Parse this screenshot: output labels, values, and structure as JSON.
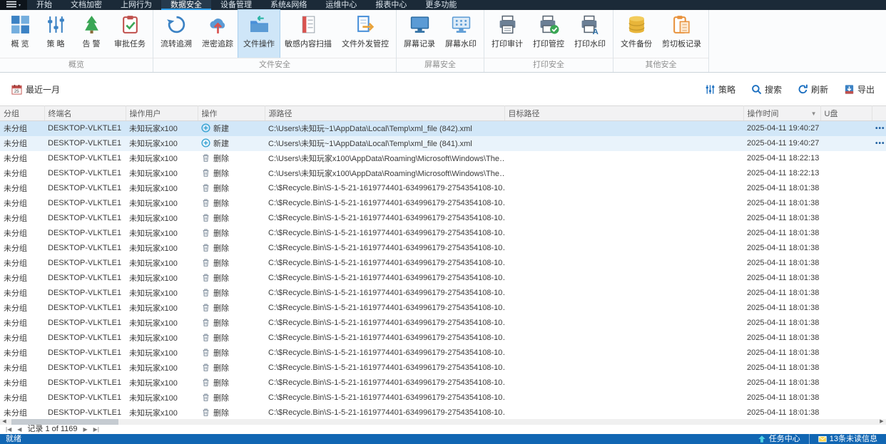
{
  "menubar": {
    "tabs": [
      {
        "label": "开始"
      },
      {
        "label": "文档加密"
      },
      {
        "label": "上网行为"
      },
      {
        "label": "数据安全",
        "active": true
      },
      {
        "label": "设备管理"
      },
      {
        "label": "系统&网络"
      },
      {
        "label": "运维中心"
      },
      {
        "label": "报表中心"
      },
      {
        "label": "更多功能"
      }
    ]
  },
  "ribbon": {
    "groups": [
      {
        "label": "概览",
        "items": [
          {
            "label": "概 览",
            "icon": "grid-icon"
          },
          {
            "label": "策 略",
            "icon": "sliders-icon"
          },
          {
            "label": "告 警",
            "icon": "alert-tree-icon"
          },
          {
            "label": "审批任务",
            "icon": "approval-clipboard-icon"
          }
        ]
      },
      {
        "label": "文件安全",
        "items": [
          {
            "label": "流转追溯",
            "icon": "flow-trace-icon"
          },
          {
            "label": "泄密追踪",
            "icon": "leak-track-icon"
          },
          {
            "label": "文件操作",
            "icon": "file-operations-icon",
            "active": true
          },
          {
            "label": "敏感内容扫描",
            "icon": "content-scan-icon"
          },
          {
            "label": "文件外发管控",
            "icon": "file-outgoing-icon"
          }
        ]
      },
      {
        "label": "屏幕安全",
        "items": [
          {
            "label": "屏幕记录",
            "icon": "screen-record-icon"
          },
          {
            "label": "屏幕水印",
            "icon": "screen-watermark-icon"
          }
        ]
      },
      {
        "label": "打印安全",
        "items": [
          {
            "label": "打印审计",
            "icon": "print-audit-icon"
          },
          {
            "label": "打印管控",
            "icon": "print-control-icon"
          },
          {
            "label": "打印水印",
            "icon": "print-watermark-icon"
          }
        ]
      },
      {
        "label": "其他安全",
        "items": [
          {
            "label": "文件备份",
            "icon": "file-backup-icon"
          },
          {
            "label": "剪切板记录",
            "icon": "clipboard-record-icon"
          }
        ]
      }
    ]
  },
  "filterbar": {
    "date_filter": {
      "label": "最近一月",
      "icon": "calendar-icon"
    },
    "actions": [
      {
        "label": "策略",
        "name": "policy-button",
        "icon": "sliders-small-icon"
      },
      {
        "label": "搜索",
        "name": "search-button",
        "icon": "search-icon"
      },
      {
        "label": "刷新",
        "name": "refresh-button",
        "icon": "refresh-icon"
      },
      {
        "label": "导出",
        "name": "export-button",
        "icon": "export-icon"
      }
    ]
  },
  "table": {
    "columns": [
      {
        "label": "分组"
      },
      {
        "label": "终端名"
      },
      {
        "label": "操作用户"
      },
      {
        "label": "操作"
      },
      {
        "label": "源路径"
      },
      {
        "label": "目标路径"
      },
      {
        "label": "操作时间",
        "dropdown": true
      },
      {
        "label": "U盘"
      }
    ],
    "chevron": "▼",
    "row_menu_glyph": "•••",
    "rows": [
      {
        "group": "未分组",
        "terminal": "DESKTOP-VLKTLE1",
        "user": "未知玩家x100",
        "op": "新建",
        "op_type": "create",
        "source": "C:\\Users\\未知玩~1\\AppData\\Local\\Temp\\xml_file (842).xml",
        "target": "",
        "time": "2025-04-11 19:40:27",
        "usb": "",
        "state": "sel1",
        "menu": true
      },
      {
        "group": "未分组",
        "terminal": "DESKTOP-VLKTLE1",
        "user": "未知玩家x100",
        "op": "新建",
        "op_type": "create",
        "source": "C:\\Users\\未知玩~1\\AppData\\Local\\Temp\\xml_file (841).xml",
        "target": "",
        "time": "2025-04-11 19:40:27",
        "usb": "",
        "state": "sel2",
        "menu": true
      },
      {
        "group": "未分组",
        "terminal": "DESKTOP-VLKTLE1",
        "user": "未知玩家x100",
        "op": "删除",
        "op_type": "delete",
        "source": "C:\\Users\\未知玩家x100\\AppData\\Roaming\\Microsoft\\Windows\\The…",
        "target": "",
        "time": "2025-04-11 18:22:13",
        "usb": "",
        "state": "",
        "menu": false
      },
      {
        "group": "未分组",
        "terminal": "DESKTOP-VLKTLE1",
        "user": "未知玩家x100",
        "op": "删除",
        "op_type": "delete",
        "source": "C:\\Users\\未知玩家x100\\AppData\\Roaming\\Microsoft\\Windows\\The…",
        "target": "",
        "time": "2025-04-11 18:22:13",
        "usb": "",
        "state": "",
        "menu": false
      },
      {
        "group": "未分组",
        "terminal": "DESKTOP-VLKTLE1",
        "user": "未知玩家x100",
        "op": "删除",
        "op_type": "delete",
        "source": "C:\\$Recycle.Bin\\S-1-5-21-1619774401-634996179-2754354108-10…",
        "target": "",
        "time": "2025-04-11 18:01:38",
        "usb": "",
        "state": "",
        "menu": false
      },
      {
        "group": "未分组",
        "terminal": "DESKTOP-VLKTLE1",
        "user": "未知玩家x100",
        "op": "删除",
        "op_type": "delete",
        "source": "C:\\$Recycle.Bin\\S-1-5-21-1619774401-634996179-2754354108-10…",
        "target": "",
        "time": "2025-04-11 18:01:38",
        "usb": "",
        "state": "",
        "menu": false
      },
      {
        "group": "未分组",
        "terminal": "DESKTOP-VLKTLE1",
        "user": "未知玩家x100",
        "op": "删除",
        "op_type": "delete",
        "source": "C:\\$Recycle.Bin\\S-1-5-21-1619774401-634996179-2754354108-10…",
        "target": "",
        "time": "2025-04-11 18:01:38",
        "usb": "",
        "state": "",
        "menu": false
      },
      {
        "group": "未分组",
        "terminal": "DESKTOP-VLKTLE1",
        "user": "未知玩家x100",
        "op": "删除",
        "op_type": "delete",
        "source": "C:\\$Recycle.Bin\\S-1-5-21-1619774401-634996179-2754354108-10…",
        "target": "",
        "time": "2025-04-11 18:01:38",
        "usb": "",
        "state": "",
        "menu": false
      },
      {
        "group": "未分组",
        "terminal": "DESKTOP-VLKTLE1",
        "user": "未知玩家x100",
        "op": "删除",
        "op_type": "delete",
        "source": "C:\\$Recycle.Bin\\S-1-5-21-1619774401-634996179-2754354108-10…",
        "target": "",
        "time": "2025-04-11 18:01:38",
        "usb": "",
        "state": "",
        "menu": false
      },
      {
        "group": "未分组",
        "terminal": "DESKTOP-VLKTLE1",
        "user": "未知玩家x100",
        "op": "删除",
        "op_type": "delete",
        "source": "C:\\$Recycle.Bin\\S-1-5-21-1619774401-634996179-2754354108-10…",
        "target": "",
        "time": "2025-04-11 18:01:38",
        "usb": "",
        "state": "",
        "menu": false
      },
      {
        "group": "未分组",
        "terminal": "DESKTOP-VLKTLE1",
        "user": "未知玩家x100",
        "op": "删除",
        "op_type": "delete",
        "source": "C:\\$Recycle.Bin\\S-1-5-21-1619774401-634996179-2754354108-10…",
        "target": "",
        "time": "2025-04-11 18:01:38",
        "usb": "",
        "state": "",
        "menu": false
      },
      {
        "group": "未分组",
        "terminal": "DESKTOP-VLKTLE1",
        "user": "未知玩家x100",
        "op": "删除",
        "op_type": "delete",
        "source": "C:\\$Recycle.Bin\\S-1-5-21-1619774401-634996179-2754354108-10…",
        "target": "",
        "time": "2025-04-11 18:01:38",
        "usb": "",
        "state": "",
        "menu": false
      },
      {
        "group": "未分组",
        "terminal": "DESKTOP-VLKTLE1",
        "user": "未知玩家x100",
        "op": "删除",
        "op_type": "delete",
        "source": "C:\\$Recycle.Bin\\S-1-5-21-1619774401-634996179-2754354108-10…",
        "target": "",
        "time": "2025-04-11 18:01:38",
        "usb": "",
        "state": "",
        "menu": false
      },
      {
        "group": "未分组",
        "terminal": "DESKTOP-VLKTLE1",
        "user": "未知玩家x100",
        "op": "删除",
        "op_type": "delete",
        "source": "C:\\$Recycle.Bin\\S-1-5-21-1619774401-634996179-2754354108-10…",
        "target": "",
        "time": "2025-04-11 18:01:38",
        "usb": "",
        "state": "",
        "menu": false
      },
      {
        "group": "未分组",
        "terminal": "DESKTOP-VLKTLE1",
        "user": "未知玩家x100",
        "op": "删除",
        "op_type": "delete",
        "source": "C:\\$Recycle.Bin\\S-1-5-21-1619774401-634996179-2754354108-10…",
        "target": "",
        "time": "2025-04-11 18:01:38",
        "usb": "",
        "state": "",
        "menu": false
      },
      {
        "group": "未分组",
        "terminal": "DESKTOP-VLKTLE1",
        "user": "未知玩家x100",
        "op": "删除",
        "op_type": "delete",
        "source": "C:\\$Recycle.Bin\\S-1-5-21-1619774401-634996179-2754354108-10…",
        "target": "",
        "time": "2025-04-11 18:01:38",
        "usb": "",
        "state": "",
        "menu": false
      },
      {
        "group": "未分组",
        "terminal": "DESKTOP-VLKTLE1",
        "user": "未知玩家x100",
        "op": "删除",
        "op_type": "delete",
        "source": "C:\\$Recycle.Bin\\S-1-5-21-1619774401-634996179-2754354108-10…",
        "target": "",
        "time": "2025-04-11 18:01:38",
        "usb": "",
        "state": "",
        "menu": false
      },
      {
        "group": "未分组",
        "terminal": "DESKTOP-VLKTLE1",
        "user": "未知玩家x100",
        "op": "删除",
        "op_type": "delete",
        "source": "C:\\$Recycle.Bin\\S-1-5-21-1619774401-634996179-2754354108-10…",
        "target": "",
        "time": "2025-04-11 18:01:38",
        "usb": "",
        "state": "",
        "menu": false
      },
      {
        "group": "未分组",
        "terminal": "DESKTOP-VLKTLE1",
        "user": "未知玩家x100",
        "op": "删除",
        "op_type": "delete",
        "source": "C:\\$Recycle.Bin\\S-1-5-21-1619774401-634996179-2754354108-10…",
        "target": "",
        "time": "2025-04-11 18:01:38",
        "usb": "",
        "state": "",
        "menu": false
      },
      {
        "group": "未分组",
        "terminal": "DESKTOP-VLKTLE1",
        "user": "未知玩家x100",
        "op": "删除",
        "op_type": "delete",
        "source": "C:\\$Recycle.Bin\\S-1-5-21-1619774401-634996179-2754354108-10…",
        "target": "",
        "time": "2025-04-11 18:01:38",
        "usb": "",
        "state": "",
        "menu": false
      }
    ]
  },
  "scrollbar": {
    "left": "◀",
    "right": "▶"
  },
  "pagination": {
    "label": "记录 1 of 1169",
    "nav": {
      "first": "|◀",
      "prev": "◀",
      "next": "▶",
      "last": "▶|"
    }
  },
  "statusbar": {
    "ready": "就绪",
    "task_center": "任务中心",
    "unread": "13条未读信息"
  },
  "colors": {
    "menubar": "#1b2a38",
    "accent": "#2d9ce8",
    "statusbar": "#1166b3",
    "selected_row": "#d2e7f8",
    "ribbon_active": "#cfe6f8"
  }
}
